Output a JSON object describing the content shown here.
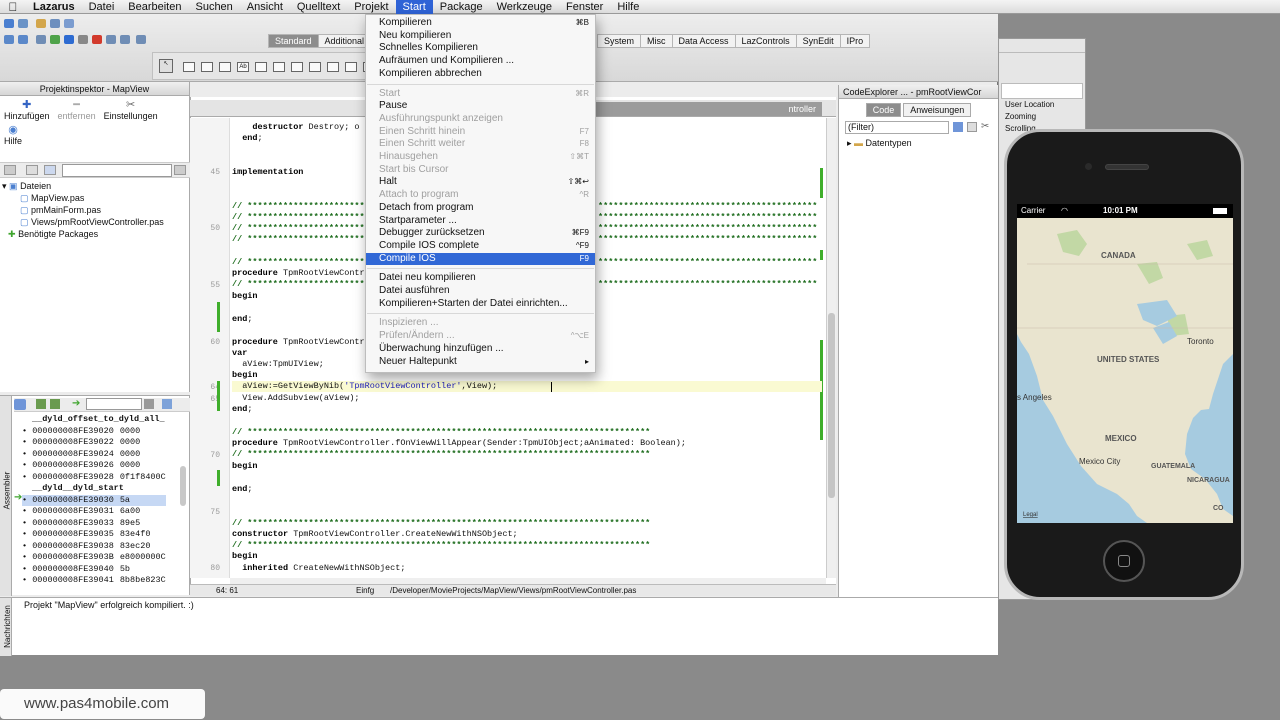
{
  "menubar": {
    "apple": "",
    "app_name": "Lazarus",
    "items": [
      "Datei",
      "Bearbeiten",
      "Suchen",
      "Ansicht",
      "Quelltext",
      "Projekt",
      "Start",
      "Package",
      "Werkzeuge",
      "Fenster",
      "Hilfe"
    ],
    "active_item": "Start"
  },
  "palette": {
    "tabs": [
      "Standard",
      "Additional"
    ],
    "selected_tab": "Standard",
    "right_tabs": [
      "System",
      "Misc",
      "Data Access",
      "LazControls",
      "SynEdit",
      "IPro"
    ]
  },
  "project_inspector": {
    "title": "Projektinspektor - MapView",
    "buttons": {
      "add": "Hinzufügen",
      "remove": "entfernen",
      "settings": "Einstellungen",
      "help": "Hilfe"
    },
    "tree": {
      "files_label": "Dateien",
      "files": [
        "MapView.pas",
        "pmMainForm.pas",
        "Views/pmRootViewController.pas"
      ],
      "packages_label": "Benötigte Packages"
    }
  },
  "assembler": {
    "label": "Assembler",
    "rows": [
      {
        "type": "header",
        "text": "__dyld_offset_to_dyld_all_"
      },
      {
        "type": "row",
        "addr": "000000008FE39020",
        "val": "0000"
      },
      {
        "type": "row",
        "addr": "000000008FE39022",
        "val": "0000"
      },
      {
        "type": "row",
        "addr": "000000008FE39024",
        "val": "0000"
      },
      {
        "type": "row",
        "addr": "000000008FE39026",
        "val": "0000"
      },
      {
        "type": "row",
        "addr": "000000008FE39028",
        "val": "0f1f8400C"
      },
      {
        "type": "header",
        "text": "__dyld__dyld_start"
      },
      {
        "type": "sel",
        "addr": "000000008FE39030",
        "val": "5a"
      },
      {
        "type": "row",
        "addr": "000000008FE39031",
        "val": "6a00"
      },
      {
        "type": "row",
        "addr": "000000008FE39033",
        "val": "89e5"
      },
      {
        "type": "row",
        "addr": "000000008FE39035",
        "val": "83e4f0"
      },
      {
        "type": "row",
        "addr": "000000008FE39038",
        "val": "83ec20"
      },
      {
        "type": "row",
        "addr": "000000008FE3903B",
        "val": "e8000000C"
      },
      {
        "type": "row",
        "addr": "000000008FE39040",
        "val": "5b"
      },
      {
        "type": "row",
        "addr": "000000008FE39041",
        "val": "8b8be823C"
      }
    ]
  },
  "editor": {
    "tab_label": "ntroller",
    "line_numbers": [
      "45",
      "50",
      "55",
      "60",
      "64",
      "65",
      "70",
      "75",
      "80"
    ],
    "status": {
      "position": "64: 61",
      "mode": "Einfg",
      "path": "/Developer/MovieProjects/MapView/Views/pmRootViewController.pas"
    }
  },
  "messages": {
    "label": "Nachrichten",
    "text": "Projekt \"MapView\" erfolgreich kompiliert. :)"
  },
  "code_explorer": {
    "title": "CodeExplorer ... - pmRootViewCor",
    "tabs": [
      "Code",
      "Anweisungen"
    ],
    "selected_tab": "Code",
    "filter_placeholder": "(Filter)",
    "tree_item": "Datentypen"
  },
  "background_window": {
    "items": [
      "User Location",
      "Zooming",
      "Scrolling"
    ]
  },
  "start_menu": {
    "items": [
      {
        "label": "Kompilieren",
        "shortcut": "⌘B",
        "enabled": true
      },
      {
        "label": "Neu kompilieren",
        "shortcut": "",
        "enabled": true
      },
      {
        "label": "Schnelles Kompilieren",
        "shortcut": "",
        "enabled": true
      },
      {
        "label": "Aufräumen und Kompilieren ...",
        "shortcut": "",
        "enabled": true
      },
      {
        "label": "Kompilieren abbrechen",
        "shortcut": "",
        "enabled": true
      },
      {
        "sep": true
      },
      {
        "label": "Start",
        "shortcut": "⌘R",
        "enabled": false
      },
      {
        "label": "Pause",
        "shortcut": "",
        "enabled": true
      },
      {
        "label": "Ausführungspunkt anzeigen",
        "shortcut": "",
        "enabled": false
      },
      {
        "label": "Einen Schritt hinein",
        "shortcut": "F7",
        "enabled": false
      },
      {
        "label": "Einen Schritt weiter",
        "shortcut": "F8",
        "enabled": false
      },
      {
        "label": "Hinausgehen",
        "shortcut": "⇧⌘T",
        "enabled": false
      },
      {
        "label": "Start bis Cursor",
        "shortcut": "",
        "enabled": false
      },
      {
        "label": "Halt",
        "shortcut": "⇧⌘↩",
        "enabled": true
      },
      {
        "label": "Attach to program",
        "shortcut": "^R",
        "enabled": false
      },
      {
        "label": "Detach from program",
        "shortcut": "",
        "enabled": true
      },
      {
        "label": "Startparameter ...",
        "shortcut": "",
        "enabled": true
      },
      {
        "label": "Debugger zurücksetzen",
        "shortcut": "⌘F9",
        "enabled": true
      },
      {
        "label": "Compile IOS complete",
        "shortcut": "^F9",
        "enabled": true
      },
      {
        "label": "Compile IOS",
        "shortcut": "F9",
        "enabled": true,
        "selected": true
      },
      {
        "sep": true
      },
      {
        "label": "Datei neu kompilieren",
        "shortcut": "",
        "enabled": true
      },
      {
        "label": "Datei ausführen",
        "shortcut": "",
        "enabled": true
      },
      {
        "label": "Kompilieren+Starten der Datei einrichten...",
        "shortcut": "",
        "enabled": true
      },
      {
        "sep": true
      },
      {
        "label": "Inspizieren ...",
        "shortcut": "",
        "enabled": false
      },
      {
        "label": "Prüfen/Ändern ...",
        "shortcut": "^⌥E",
        "enabled": false
      },
      {
        "label": "Überwachung hinzufügen ...",
        "shortcut": "",
        "enabled": true
      },
      {
        "label": "Neuer Haltepunkt",
        "shortcut": "▸",
        "enabled": true
      }
    ]
  },
  "iphone": {
    "carrier": "Carrier",
    "time": "10:01 PM",
    "map_labels": {
      "canada": "CANADA",
      "us": "UNITED STATES",
      "toronto": "Toronto",
      "losangeles": "s Angeles",
      "mexico": "MEXICO",
      "mexicocity": "Mexico City",
      "guatemala": "GUATEMALA",
      "nicaragua": "NICARAGUA",
      "co": "CO",
      "legal": "Legal"
    },
    "colors": {
      "land": "#e9e4cf",
      "water": "#a6cbe0",
      "forest": "#b8d59a"
    }
  },
  "watermark": "www.pas4mobile.com",
  "colors": {
    "menu_highlight": "#3168d6",
    "change_bar": "#3fae2b"
  }
}
